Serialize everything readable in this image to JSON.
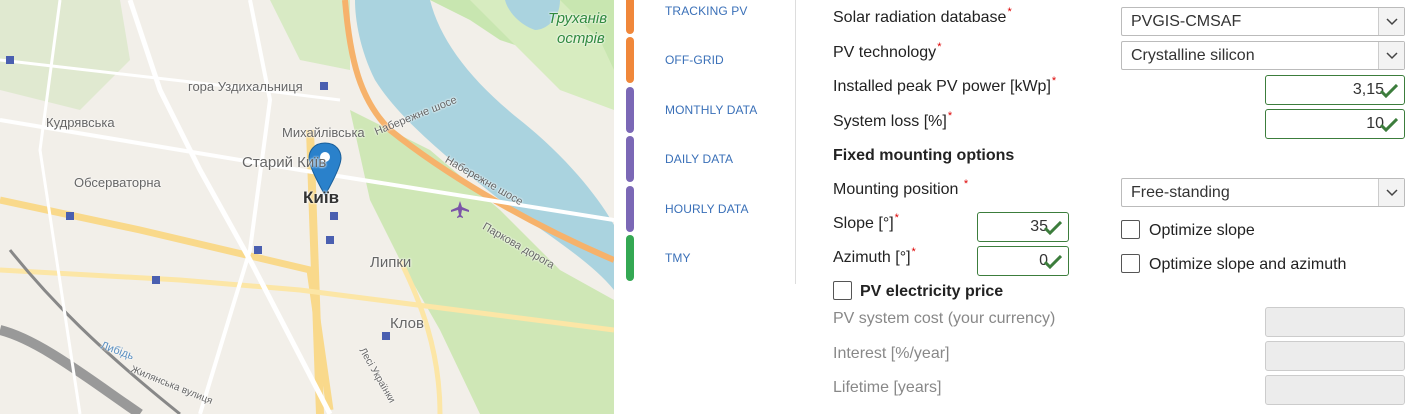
{
  "map": {
    "labels": {
      "trukhaniv": "Труханів",
      "ostriv": "острів",
      "hora": "гора Уздихальниця",
      "kudriavska": "Кудрявська",
      "mykhailivska": "Михайлівська",
      "naberezhne1": "Набережне шосе",
      "naberezhne2": "Набережне шосе",
      "staryi_kyiv": "Старий Київ",
      "observatorna": "Обсерваторна",
      "kyiv": "Київ",
      "parkova": "Паркова дорога",
      "lypky": "Липки",
      "klov": "Клов",
      "lybid": "Либідь",
      "zhylianska": "Жилянська вулиця",
      "lesi": "Лесі Українки"
    },
    "marker_icon": "map-pin-icon",
    "airport_icon": "plane-icon"
  },
  "tabs": [
    {
      "label": "TRACKING PV",
      "color": "#f0873a"
    },
    {
      "label": "OFF-GRID",
      "color": "#f0873a"
    },
    {
      "label": "MONTHLY DATA",
      "color": "#7b68b6"
    },
    {
      "label": "DAILY DATA",
      "color": "#7b68b6"
    },
    {
      "label": "HOURLY DATA",
      "color": "#7b68b6"
    },
    {
      "label": "TMY",
      "color": "#34a853"
    }
  ],
  "form": {
    "radiation_db": {
      "label": "Solar radiation database",
      "value": "PVGIS-CMSAF"
    },
    "pv_tech": {
      "label": "PV technology",
      "value": "Crystalline silicon"
    },
    "peak_power": {
      "label": "Installed peak PV power [kWp]",
      "value": "3,15"
    },
    "system_loss": {
      "label": "System loss [%]",
      "value": "10"
    },
    "fixed_heading": "Fixed mounting options",
    "mounting": {
      "label": "Mounting position",
      "value": "Free-standing"
    },
    "slope": {
      "label": "Slope [°]",
      "value": "35"
    },
    "azimuth": {
      "label": "Azimuth [°]",
      "value": "0"
    },
    "optimize_slope": "Optimize slope",
    "optimize_both": "Optimize slope and azimuth",
    "price_heading": "PV electricity price",
    "cost": "PV system cost (your currency)",
    "interest": "Interest [%/year]",
    "lifetime": "Lifetime [years]"
  }
}
